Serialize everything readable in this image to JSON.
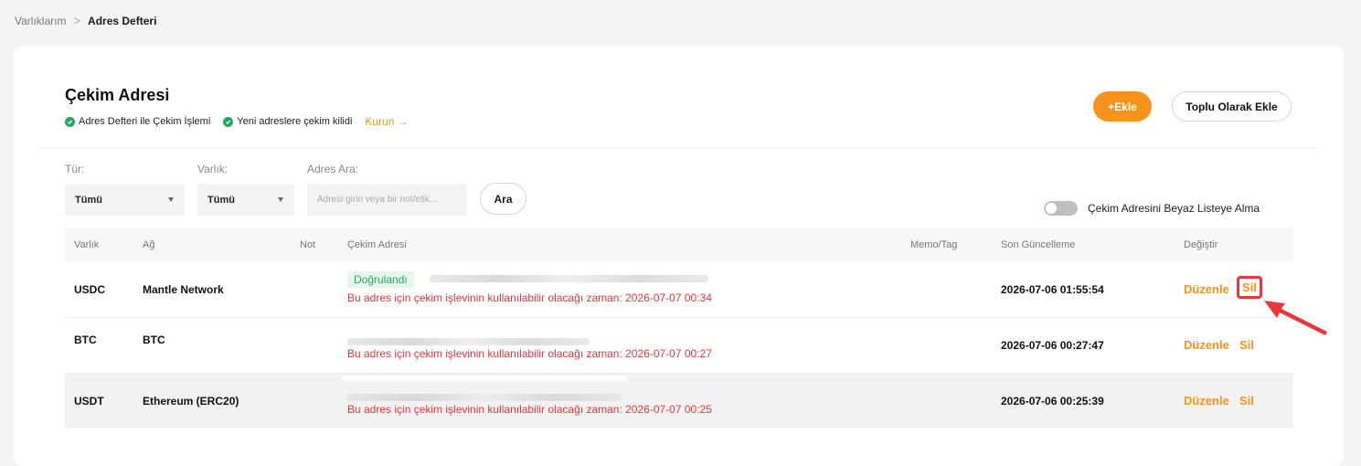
{
  "breadcrumb": {
    "parent": "Varlıklarım",
    "separator": ">",
    "current": "Adres Defteri"
  },
  "header": {
    "title": "Çekim Adresi",
    "features": [
      "Adres Defteri ile Çekim İşlemi",
      "Yeni adreslere çekim kilidi"
    ],
    "setup_link": "Kurun →",
    "add_button": "+Ekle",
    "bulk_add_button": "Toplu Olarak Ekle"
  },
  "filters": {
    "type_label": "Tür:",
    "type_value": "Tümü",
    "asset_label": "Varlık:",
    "asset_value": "Tümü",
    "search_label": "Adres Ara:",
    "search_placeholder": "Adresi girin veya bir not/etik...",
    "search_button": "Ara",
    "whitelist_toggle_label": "Çekim Adresini Beyaz Listeye Alma",
    "whitelist_enabled": false
  },
  "table": {
    "columns": [
      "Varlık",
      "Ağ",
      "Not",
      "Çekim Adresi",
      "Memo/Tag",
      "Son Güncelleme",
      "Değiştir"
    ],
    "rows": [
      {
        "asset": "USDC",
        "network": "Mantle Network",
        "badge": "Doğrulandı",
        "warning": "Bu adres için çekim işlevinin kullanılabilir olacağı zaman: 2026-07-07 00:34",
        "updated": "2026-07-06 01:55:54",
        "edit": "Düzenle",
        "delete": "Sil"
      },
      {
        "asset": "BTC",
        "network": "BTC",
        "badge": "",
        "warning": "Bu adres için çekim işlevinin kullanılabilir olacağı zaman: 2026-07-07 00:27",
        "updated": "2026-07-06 00:27:47",
        "edit": "Düzenle",
        "delete": "Sil"
      },
      {
        "asset": "USDT",
        "network": "Ethereum (ERC20)",
        "badge": "",
        "warning": "Bu adres için çekim işlevinin kullanılabilir olacağı zaman: 2026-07-07 00:25",
        "updated": "2026-07-06 00:25:39",
        "edit": "Düzenle",
        "delete": "Sil"
      }
    ]
  },
  "colors": {
    "accent": "#f7931a",
    "success": "#27a561",
    "danger": "#e8363a"
  }
}
